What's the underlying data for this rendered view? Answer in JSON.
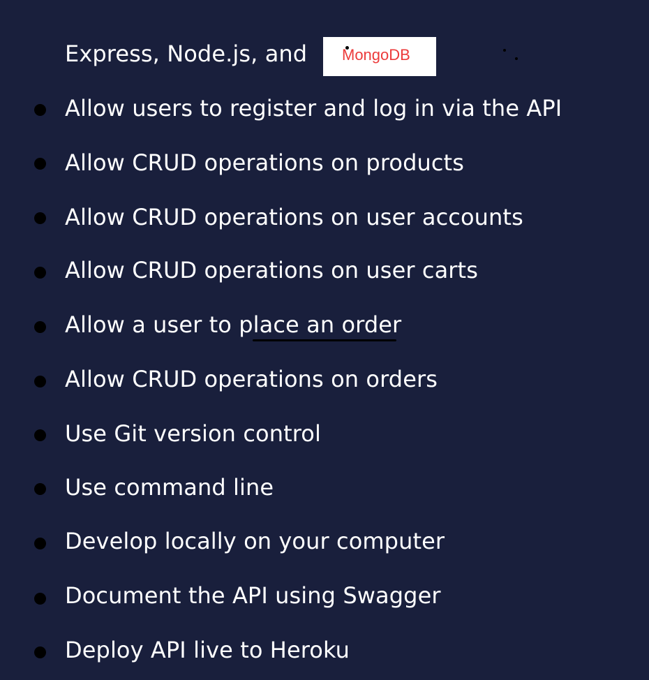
{
  "intro": {
    "text": "Express, Node.js, and",
    "badge_text": "MongoDB"
  },
  "requirements": [
    "Allow users to register and log in via the API",
    "Allow CRUD operations on products",
    "Allow CRUD operations on user accounts",
    "Allow CRUD operations on user carts",
    "Allow a user to place an order",
    "Allow CRUD operations on orders",
    "Use Git version control",
    "Use command line",
    "Develop locally on your computer",
    "Document the API using Swagger",
    "Deploy API live to Heroku"
  ],
  "colors": {
    "background": "#191f3c",
    "text": "#ffffff",
    "bullet": "#000000",
    "badge_text": "#ec3b3b"
  }
}
